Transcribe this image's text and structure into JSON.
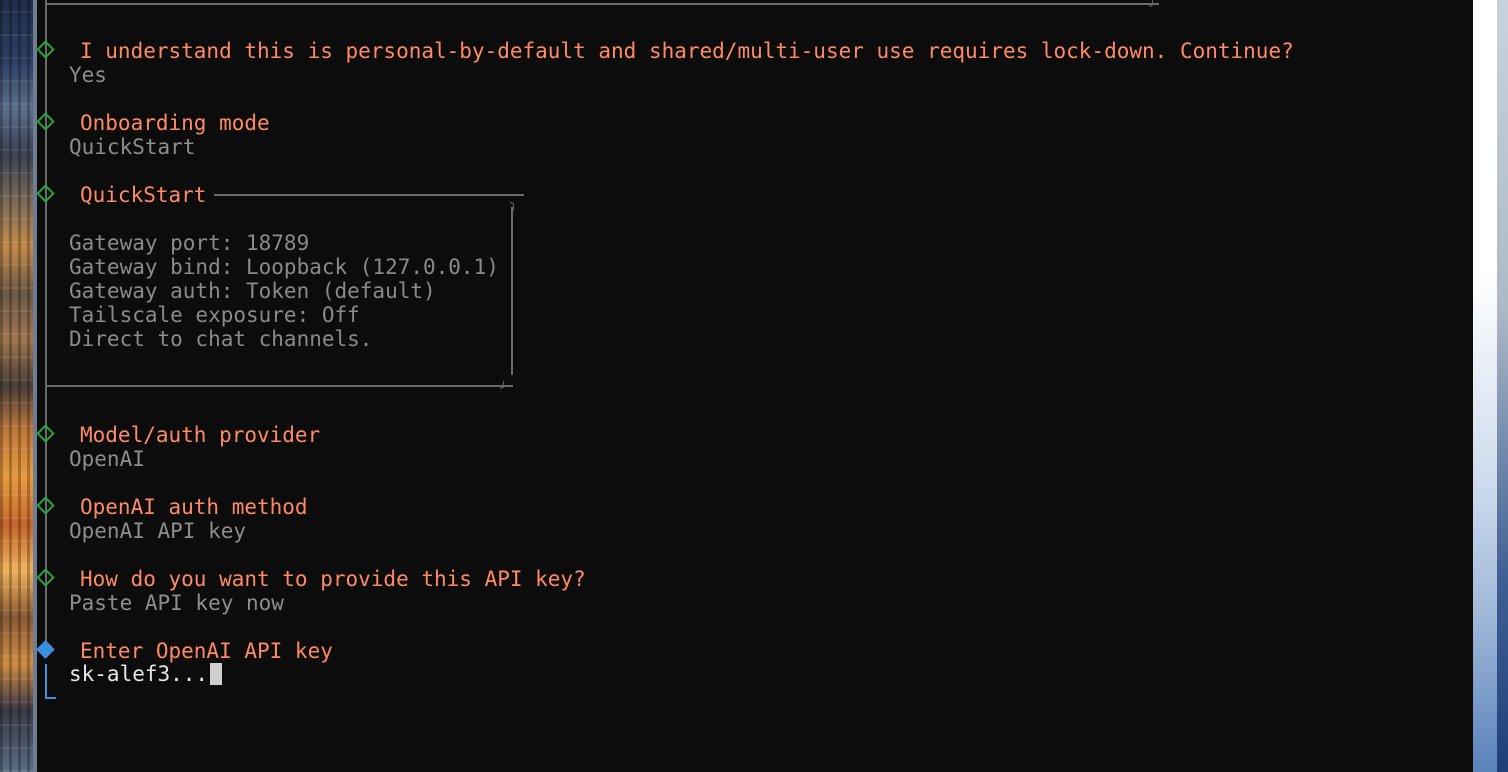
{
  "prompts": [
    {
      "question": "I understand this is personal-by-default and shared/multi-user use requires lock-down. Continue?",
      "answer": "Yes"
    },
    {
      "question": "Onboarding mode",
      "answer": "QuickStart"
    }
  ],
  "quickstart_box": {
    "title": "QuickStart",
    "lines": [
      "Gateway port: 18789",
      "Gateway bind: Loopback (127.0.0.1)",
      "Gateway auth: Token (default)",
      "Tailscale exposure: Off",
      "Direct to chat channels."
    ]
  },
  "prompts_after": [
    {
      "question": "Model/auth provider",
      "answer": "OpenAI"
    },
    {
      "question": "OpenAI auth method",
      "answer": "OpenAI API key"
    },
    {
      "question": "How do you want to provide this API key?",
      "answer": "Paste API key now"
    }
  ],
  "active_prompt": {
    "question": "Enter OpenAI API key",
    "value": "sk-alef3..."
  },
  "colors": {
    "question": "#ff8a62",
    "answer": "#8d8d8d",
    "done_marker": "#27a33c",
    "active_marker": "#3a8fe0"
  }
}
